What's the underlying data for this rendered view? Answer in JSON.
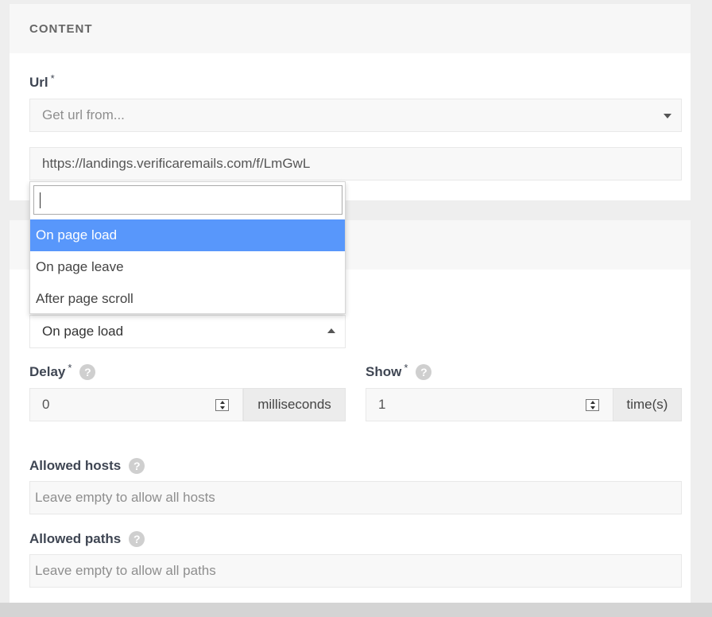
{
  "content_section": {
    "title": "CONTENT",
    "url_label": "Url",
    "required_mark": "*",
    "url_select_placeholder": "Get url from...",
    "url_value": "https://landings.verificaremails.com/f/LmGwL"
  },
  "trigger_section": {
    "trigger_select_value": "On page load",
    "dropdown": {
      "search_value": "",
      "options": [
        "On page load",
        "On page leave",
        "After page scroll"
      ],
      "highlighted": "On page load"
    },
    "delay": {
      "label": "Delay",
      "required_mark": "*",
      "help": "?",
      "value": "0",
      "unit": "milliseconds"
    },
    "show": {
      "label": "Show",
      "required_mark": "*",
      "help": "?",
      "value": "1",
      "unit": "time(s)"
    },
    "allowed_hosts": {
      "label": "Allowed hosts",
      "help": "?",
      "placeholder": "Leave empty to allow all hosts"
    },
    "allowed_paths": {
      "label": "Allowed paths",
      "help": "?",
      "placeholder": "Leave empty to allow all paths"
    }
  },
  "colors": {
    "highlight": "#5897fb",
    "label": "#3f4653",
    "field_bg": "#f8f8f8"
  }
}
